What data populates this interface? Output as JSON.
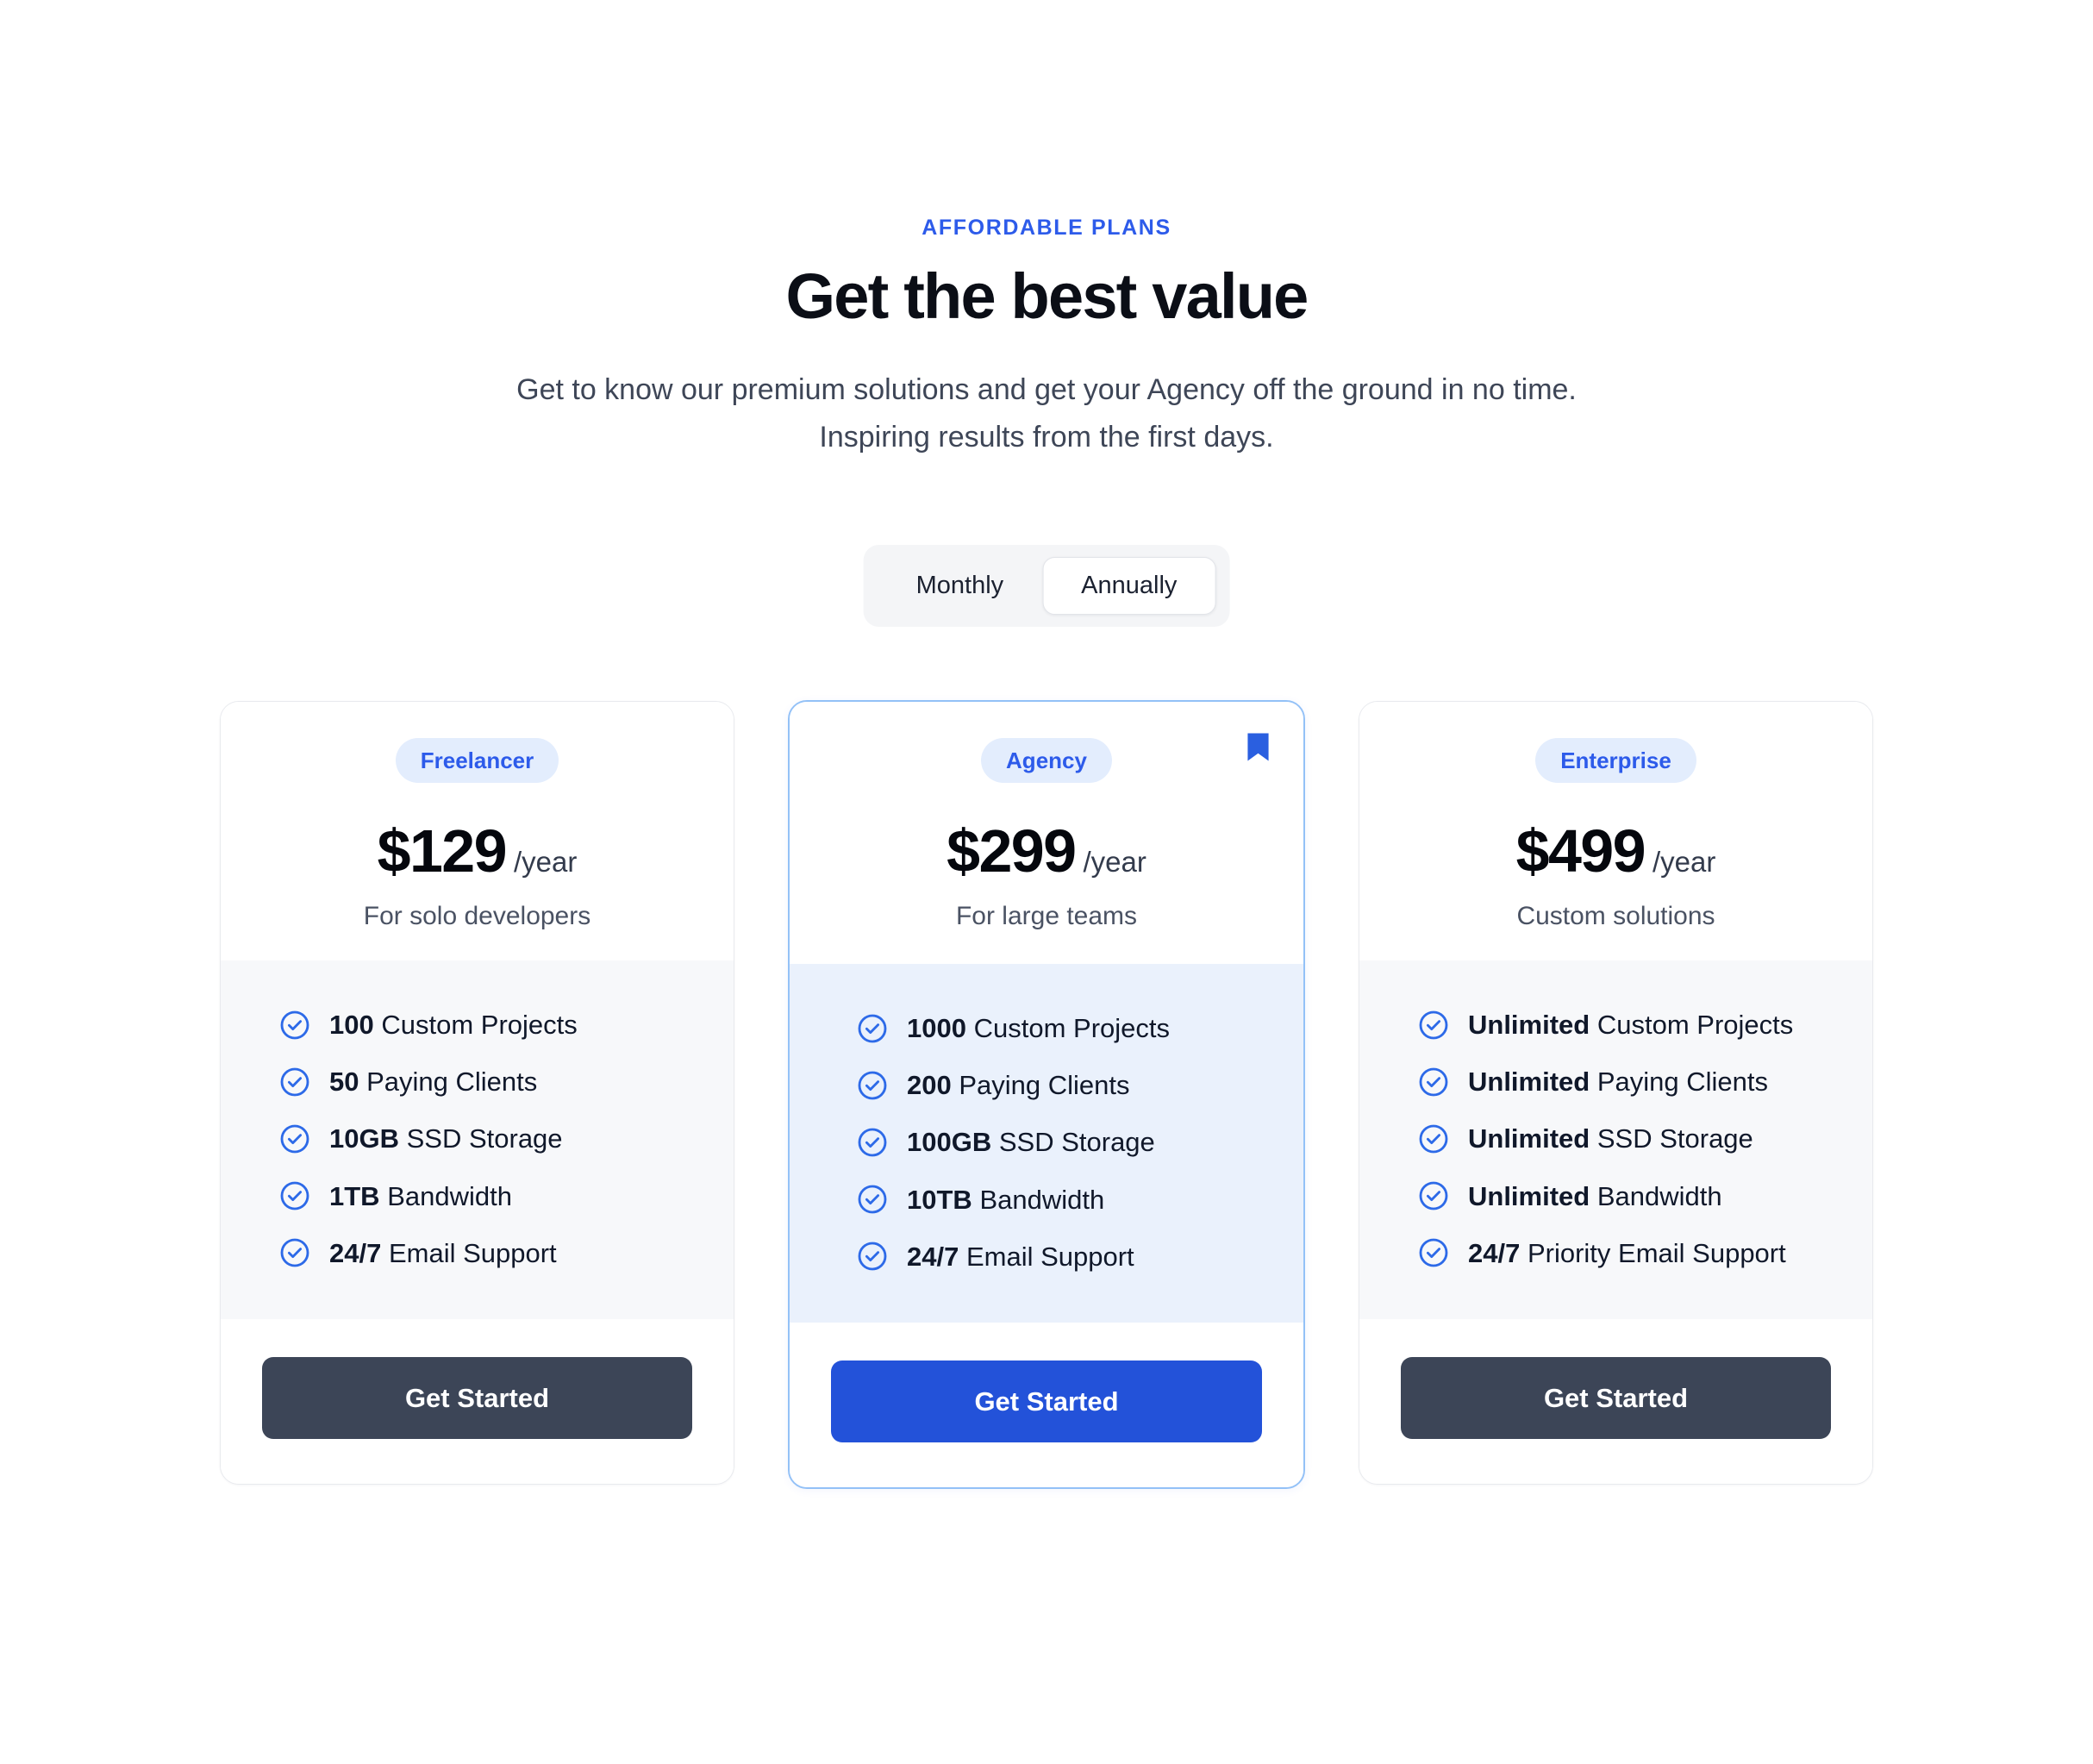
{
  "header": {
    "eyebrow": "AFFORDABLE PLANS",
    "headline": "Get the best value",
    "subtitle": "Get to know our premium solutions and get your Agency off the ground in no time. Inspiring results from the first days."
  },
  "billing_toggle": {
    "options": [
      {
        "label": "Monthly",
        "active": false
      },
      {
        "label": "Annually",
        "active": true
      }
    ],
    "selected": "Annually"
  },
  "colors": {
    "accent_blue": "#2352d9",
    "badge_text": "#2d5bea",
    "badge_bg": "#e3edfd",
    "featured_border": "#93c1f7",
    "featured_feature_bg": "#eaf1fc",
    "feature_bg": "#f7f8fa",
    "dark_button": "#3c4557",
    "headline": "#0b0e16"
  },
  "plans": [
    {
      "badge": "Freelancer",
      "price": "$129",
      "period": "/year",
      "description": "For solo developers",
      "featured": false,
      "bookmarked": false,
      "features": [
        {
          "value": "100",
          "label": "Custom Projects"
        },
        {
          "value": "50",
          "label": "Paying Clients"
        },
        {
          "value": "10GB",
          "label": "SSD Storage"
        },
        {
          "value": "1TB",
          "label": "Bandwidth"
        },
        {
          "value": "24/7",
          "label": "Email Support"
        }
      ],
      "cta": "Get Started"
    },
    {
      "badge": "Agency",
      "price": "$299",
      "period": "/year",
      "description": "For large teams",
      "featured": true,
      "bookmarked": true,
      "features": [
        {
          "value": "1000",
          "label": "Custom Projects"
        },
        {
          "value": "200",
          "label": "Paying Clients"
        },
        {
          "value": "100GB",
          "label": "SSD Storage"
        },
        {
          "value": "10TB",
          "label": "Bandwidth"
        },
        {
          "value": "24/7",
          "label": "Email Support"
        }
      ],
      "cta": "Get Started"
    },
    {
      "badge": "Enterprise",
      "price": "$499",
      "period": "/year",
      "description": "Custom solutions",
      "featured": false,
      "bookmarked": false,
      "features": [
        {
          "value": "Unlimited",
          "label": "Custom Projects"
        },
        {
          "value": "Unlimited",
          "label": "Paying Clients"
        },
        {
          "value": "Unlimited",
          "label": "SSD Storage"
        },
        {
          "value": "Unlimited",
          "label": "Bandwidth"
        },
        {
          "value": "24/7",
          "label": "Priority Email Support"
        }
      ],
      "cta": "Get Started"
    }
  ],
  "icons": {
    "check": "check-circle-icon",
    "bookmark": "bookmark-icon"
  }
}
